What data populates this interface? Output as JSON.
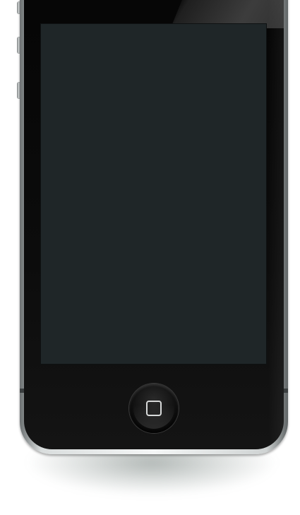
{
  "device": {
    "model": "smartphone",
    "screen_state": "off"
  },
  "colors": {
    "screen": "#1f2628",
    "bezel": "#0a0a0a",
    "frame": "#dfe2e2",
    "background": "#ffffff"
  },
  "icons": {
    "home": "home-square-icon"
  }
}
